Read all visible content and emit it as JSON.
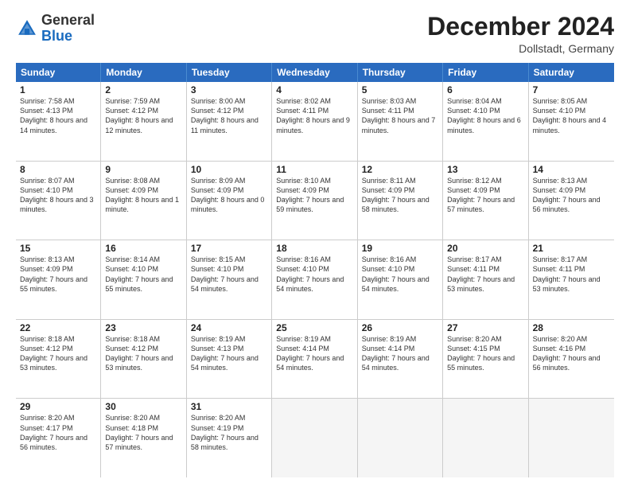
{
  "header": {
    "logo": {
      "general": "General",
      "blue": "Blue"
    },
    "month_title": "December 2024",
    "location": "Dollstadt, Germany"
  },
  "weekdays": [
    "Sunday",
    "Monday",
    "Tuesday",
    "Wednesday",
    "Thursday",
    "Friday",
    "Saturday"
  ],
  "rows": [
    [
      {
        "day": "1",
        "sunrise": "Sunrise: 7:58 AM",
        "sunset": "Sunset: 4:13 PM",
        "daylight": "Daylight: 8 hours and 14 minutes."
      },
      {
        "day": "2",
        "sunrise": "Sunrise: 7:59 AM",
        "sunset": "Sunset: 4:12 PM",
        "daylight": "Daylight: 8 hours and 12 minutes."
      },
      {
        "day": "3",
        "sunrise": "Sunrise: 8:00 AM",
        "sunset": "Sunset: 4:12 PM",
        "daylight": "Daylight: 8 hours and 11 minutes."
      },
      {
        "day": "4",
        "sunrise": "Sunrise: 8:02 AM",
        "sunset": "Sunset: 4:11 PM",
        "daylight": "Daylight: 8 hours and 9 minutes."
      },
      {
        "day": "5",
        "sunrise": "Sunrise: 8:03 AM",
        "sunset": "Sunset: 4:11 PM",
        "daylight": "Daylight: 8 hours and 7 minutes."
      },
      {
        "day": "6",
        "sunrise": "Sunrise: 8:04 AM",
        "sunset": "Sunset: 4:10 PM",
        "daylight": "Daylight: 8 hours and 6 minutes."
      },
      {
        "day": "7",
        "sunrise": "Sunrise: 8:05 AM",
        "sunset": "Sunset: 4:10 PM",
        "daylight": "Daylight: 8 hours and 4 minutes."
      }
    ],
    [
      {
        "day": "8",
        "sunrise": "Sunrise: 8:07 AM",
        "sunset": "Sunset: 4:10 PM",
        "daylight": "Daylight: 8 hours and 3 minutes."
      },
      {
        "day": "9",
        "sunrise": "Sunrise: 8:08 AM",
        "sunset": "Sunset: 4:09 PM",
        "daylight": "Daylight: 8 hours and 1 minute."
      },
      {
        "day": "10",
        "sunrise": "Sunrise: 8:09 AM",
        "sunset": "Sunset: 4:09 PM",
        "daylight": "Daylight: 8 hours and 0 minutes."
      },
      {
        "day": "11",
        "sunrise": "Sunrise: 8:10 AM",
        "sunset": "Sunset: 4:09 PM",
        "daylight": "Daylight: 7 hours and 59 minutes."
      },
      {
        "day": "12",
        "sunrise": "Sunrise: 8:11 AM",
        "sunset": "Sunset: 4:09 PM",
        "daylight": "Daylight: 7 hours and 58 minutes."
      },
      {
        "day": "13",
        "sunrise": "Sunrise: 8:12 AM",
        "sunset": "Sunset: 4:09 PM",
        "daylight": "Daylight: 7 hours and 57 minutes."
      },
      {
        "day": "14",
        "sunrise": "Sunrise: 8:13 AM",
        "sunset": "Sunset: 4:09 PM",
        "daylight": "Daylight: 7 hours and 56 minutes."
      }
    ],
    [
      {
        "day": "15",
        "sunrise": "Sunrise: 8:13 AM",
        "sunset": "Sunset: 4:09 PM",
        "daylight": "Daylight: 7 hours and 55 minutes."
      },
      {
        "day": "16",
        "sunrise": "Sunrise: 8:14 AM",
        "sunset": "Sunset: 4:10 PM",
        "daylight": "Daylight: 7 hours and 55 minutes."
      },
      {
        "day": "17",
        "sunrise": "Sunrise: 8:15 AM",
        "sunset": "Sunset: 4:10 PM",
        "daylight": "Daylight: 7 hours and 54 minutes."
      },
      {
        "day": "18",
        "sunrise": "Sunrise: 8:16 AM",
        "sunset": "Sunset: 4:10 PM",
        "daylight": "Daylight: 7 hours and 54 minutes."
      },
      {
        "day": "19",
        "sunrise": "Sunrise: 8:16 AM",
        "sunset": "Sunset: 4:10 PM",
        "daylight": "Daylight: 7 hours and 54 minutes."
      },
      {
        "day": "20",
        "sunrise": "Sunrise: 8:17 AM",
        "sunset": "Sunset: 4:11 PM",
        "daylight": "Daylight: 7 hours and 53 minutes."
      },
      {
        "day": "21",
        "sunrise": "Sunrise: 8:17 AM",
        "sunset": "Sunset: 4:11 PM",
        "daylight": "Daylight: 7 hours and 53 minutes."
      }
    ],
    [
      {
        "day": "22",
        "sunrise": "Sunrise: 8:18 AM",
        "sunset": "Sunset: 4:12 PM",
        "daylight": "Daylight: 7 hours and 53 minutes."
      },
      {
        "day": "23",
        "sunrise": "Sunrise: 8:18 AM",
        "sunset": "Sunset: 4:12 PM",
        "daylight": "Daylight: 7 hours and 53 minutes."
      },
      {
        "day": "24",
        "sunrise": "Sunrise: 8:19 AM",
        "sunset": "Sunset: 4:13 PM",
        "daylight": "Daylight: 7 hours and 54 minutes."
      },
      {
        "day": "25",
        "sunrise": "Sunrise: 8:19 AM",
        "sunset": "Sunset: 4:14 PM",
        "daylight": "Daylight: 7 hours and 54 minutes."
      },
      {
        "day": "26",
        "sunrise": "Sunrise: 8:19 AM",
        "sunset": "Sunset: 4:14 PM",
        "daylight": "Daylight: 7 hours and 54 minutes."
      },
      {
        "day": "27",
        "sunrise": "Sunrise: 8:20 AM",
        "sunset": "Sunset: 4:15 PM",
        "daylight": "Daylight: 7 hours and 55 minutes."
      },
      {
        "day": "28",
        "sunrise": "Sunrise: 8:20 AM",
        "sunset": "Sunset: 4:16 PM",
        "daylight": "Daylight: 7 hours and 56 minutes."
      }
    ],
    [
      {
        "day": "29",
        "sunrise": "Sunrise: 8:20 AM",
        "sunset": "Sunset: 4:17 PM",
        "daylight": "Daylight: 7 hours and 56 minutes."
      },
      {
        "day": "30",
        "sunrise": "Sunrise: 8:20 AM",
        "sunset": "Sunset: 4:18 PM",
        "daylight": "Daylight: 7 hours and 57 minutes."
      },
      {
        "day": "31",
        "sunrise": "Sunrise: 8:20 AM",
        "sunset": "Sunset: 4:19 PM",
        "daylight": "Daylight: 7 hours and 58 minutes."
      },
      null,
      null,
      null,
      null
    ]
  ]
}
